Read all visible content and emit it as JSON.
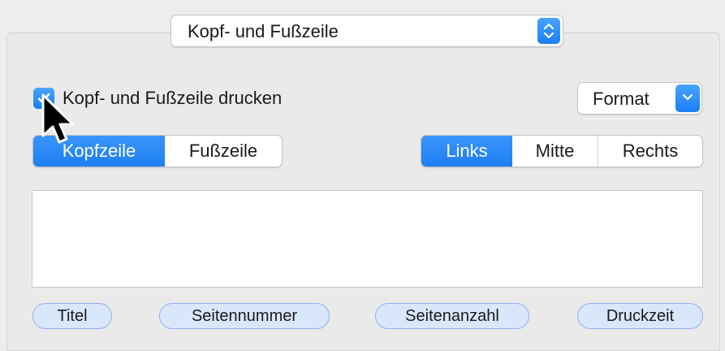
{
  "section_popup": {
    "selected": "Kopf- und Fußzeile",
    "icon": "chevron-up-down-icon"
  },
  "print_checkbox": {
    "label": "Kopf- und Fußzeile drucken",
    "checked": true,
    "icon": "checkmark-icon"
  },
  "format_popup": {
    "label": "Format",
    "icon": "chevron-down-icon"
  },
  "header_footer_tabs": {
    "items": [
      "Kopfzeile",
      "Fußzeile"
    ],
    "active": "Kopfzeile"
  },
  "alignment_tabs": {
    "items": [
      "Links",
      "Mitte",
      "Rechts"
    ],
    "active": "Links"
  },
  "text_area": {
    "value": ""
  },
  "tokens": {
    "title": "Titel",
    "page_number": "Seitennummer",
    "page_count": "Seitenanzahl",
    "print_time": "Druckzeit"
  },
  "colors": {
    "accent": "#1e7ff2",
    "token_bg": "#d9e7fb",
    "token_border": "#8fb3e6"
  },
  "cursor": {
    "icon": "mouse-pointer-icon"
  }
}
